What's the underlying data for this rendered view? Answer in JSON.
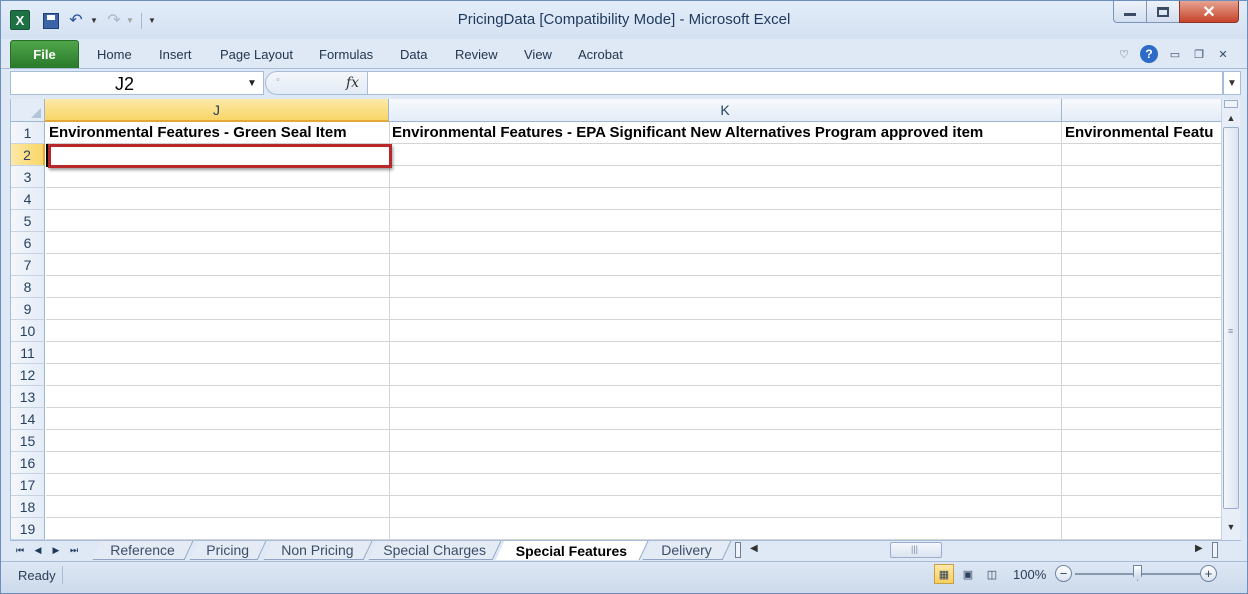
{
  "window": {
    "title": "PricingData  [Compatibility Mode]  -  Microsoft Excel",
    "app_icon_letter": "X"
  },
  "ribbon": {
    "file_label": "File",
    "tabs": [
      "Home",
      "Insert",
      "Page Layout",
      "Formulas",
      "Data",
      "Review",
      "View",
      "Acrobat"
    ]
  },
  "formula_bar": {
    "name_box": "J2",
    "fx_label": "fx",
    "formula": ""
  },
  "grid": {
    "active_cell": "J2",
    "columns": [
      "J",
      "K",
      ""
    ],
    "rows": [
      "1",
      "2",
      "3",
      "4",
      "5",
      "6",
      "7",
      "8",
      "9",
      "10",
      "11",
      "12",
      "13",
      "14",
      "15",
      "16",
      "17",
      "18",
      "19"
    ],
    "row1": [
      "Environmental Features - Green Seal Item",
      "Environmental Features - EPA Significant New Alternatives Program approved item",
      "Environmental Featu"
    ]
  },
  "sheet_tabs": {
    "tabs": [
      "Reference",
      "Pricing",
      "Non Pricing",
      "Special Charges",
      "Special Features",
      "Delivery"
    ],
    "active": "Special Features"
  },
  "status_bar": {
    "status": "Ready",
    "zoom": "100%",
    "zoom_fraction": 0.5
  },
  "colors": {
    "file_tab": "#2a7a2a",
    "annotation": "#b8282a",
    "active_header": "#f9d668"
  }
}
